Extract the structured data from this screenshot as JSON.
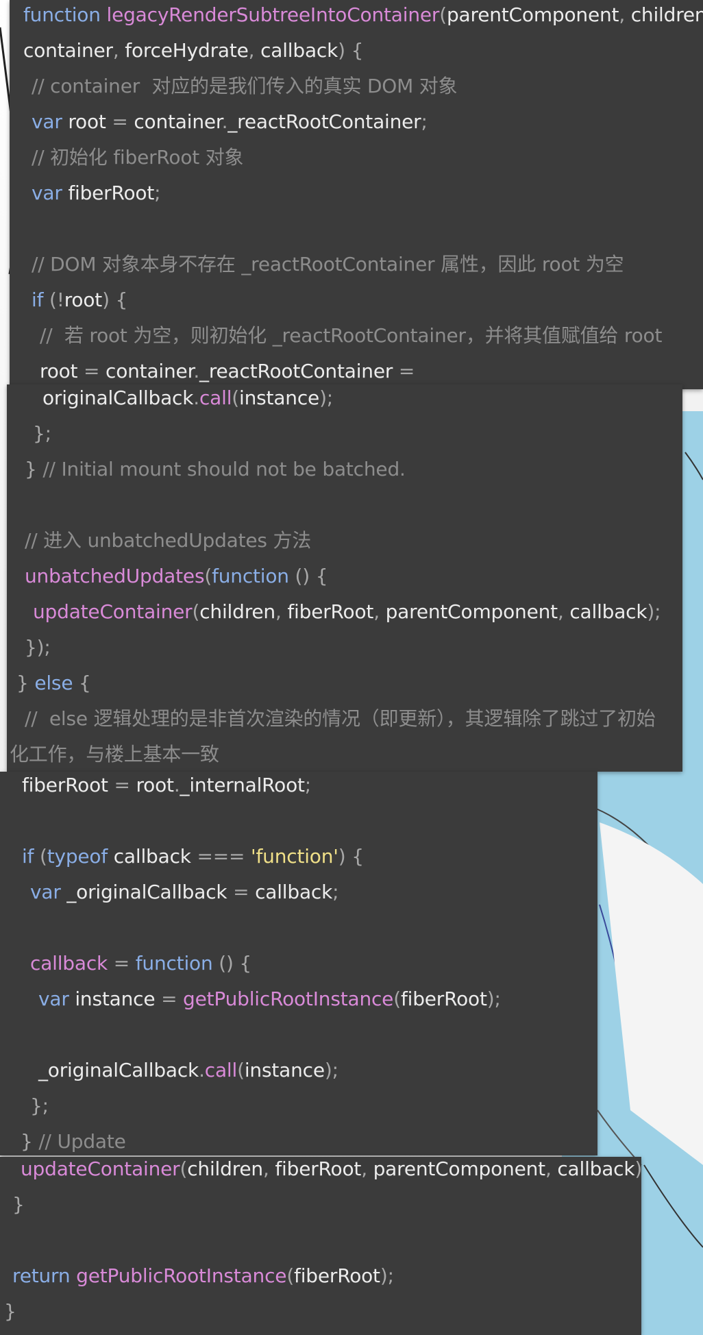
{
  "colors": {
    "panel_bg": "#3b3b3b",
    "keyword": "#8aaee6",
    "function": "#d98ad8",
    "string": "#f0e088",
    "comment": "#8d8d8d",
    "text": "#ececec"
  },
  "blocks": [
    {
      "lines": [
        [
          [
            "function",
            "kw"
          ],
          [
            " ",
            "tx"
          ],
          [
            "legacyRenderSubtreeIntoContainer",
            "fn"
          ],
          [
            "(",
            "pn"
          ],
          [
            "parentComponent",
            "tx"
          ],
          [
            ", ",
            "pn"
          ],
          [
            "children",
            "tx"
          ],
          [
            ",",
            "pn"
          ]
        ],
        [
          [
            "container",
            "tx"
          ],
          [
            ", ",
            "pn"
          ],
          [
            "forceHydrate",
            "tx"
          ],
          [
            ", ",
            "pn"
          ],
          [
            "callback",
            "tx"
          ],
          [
            ") {",
            "pn"
          ]
        ],
        [
          [
            "// container  对应的是我们传入的真实 DOM 对象",
            "cm"
          ]
        ],
        [
          [
            "var",
            "kw"
          ],
          [
            " root ",
            "tx"
          ],
          [
            "=",
            "pn"
          ],
          [
            " container",
            "tx"
          ],
          [
            ".",
            "pn"
          ],
          [
            "_reactRootContainer",
            "tx"
          ],
          [
            ";",
            "pn"
          ]
        ],
        [
          [
            "// 初始化 fiberRoot 对象",
            "cm"
          ]
        ],
        [
          [
            "var",
            "kw"
          ],
          [
            " fiberRoot",
            "tx"
          ],
          [
            ";",
            "pn"
          ]
        ],
        [],
        [
          [
            "// DOM 对象本身不存在 _reactRootContainer 属性，因此 root 为空",
            "cm"
          ]
        ],
        [
          [
            "if",
            "kw"
          ],
          [
            " (",
            "pn"
          ],
          [
            "!",
            "pn"
          ],
          [
            "root",
            "tx"
          ],
          [
            ") {",
            "pn"
          ]
        ],
        [
          [
            "//  若 root 为空，则初始化 _reactRootContainer，并将其值赋值给 root",
            "cm"
          ]
        ],
        [
          [
            "root ",
            "tx"
          ],
          [
            "=",
            "pn"
          ],
          [
            " container",
            "tx"
          ],
          [
            ".",
            "pn"
          ],
          [
            "_reactRootContainer ",
            "tx"
          ],
          [
            "=",
            "pn"
          ]
        ]
      ]
    },
    {
      "lines": [
        [
          [
            "originalCallback",
            "tx"
          ],
          [
            ".",
            "pn"
          ],
          [
            "call",
            "fn"
          ],
          [
            "(",
            "pn"
          ],
          [
            "instance",
            "tx"
          ],
          [
            ");",
            "pn"
          ]
        ],
        [
          [
            "};",
            "pn"
          ]
        ],
        [
          [
            "} ",
            "pn"
          ],
          [
            "// Initial mount should not be batched.",
            "cm"
          ]
        ],
        [],
        [
          [
            "// 进入 unbatchedUpdates 方法",
            "cm"
          ]
        ],
        [
          [
            "unbatchedUpdates",
            "fn"
          ],
          [
            "(",
            "pn"
          ],
          [
            "function",
            "kw"
          ],
          [
            " () {",
            "pn"
          ]
        ],
        [
          [
            "updateContainer",
            "fn"
          ],
          [
            "(",
            "pn"
          ],
          [
            "children",
            "tx"
          ],
          [
            ", ",
            "pn"
          ],
          [
            "fiberRoot",
            "tx"
          ],
          [
            ", ",
            "pn"
          ],
          [
            "parentComponent",
            "tx"
          ],
          [
            ", ",
            "pn"
          ],
          [
            "callback",
            "tx"
          ],
          [
            ");",
            "pn"
          ]
        ],
        [
          [
            "});",
            "pn"
          ]
        ],
        [
          [
            "} ",
            "pn"
          ],
          [
            "else",
            "kw"
          ],
          [
            " {",
            "pn"
          ]
        ],
        [
          [
            "//  else 逻辑处理的是非首次渲染的情况（即更新），其逻辑除了跳过了初始",
            "cm"
          ]
        ],
        [
          [
            "化工作，与楼上基本一致",
            "cm"
          ]
        ]
      ]
    },
    {
      "lines": [
        [
          [
            "fiberRoot ",
            "tx"
          ],
          [
            "=",
            "pn"
          ],
          [
            " root",
            "tx"
          ],
          [
            ".",
            "pn"
          ],
          [
            "_internalRoot",
            "tx"
          ],
          [
            ";",
            "pn"
          ]
        ],
        [],
        [
          [
            "if",
            "kw"
          ],
          [
            " (",
            "pn"
          ],
          [
            "typeof",
            "kw"
          ],
          [
            " callback ",
            "tx"
          ],
          [
            "===",
            "pn"
          ],
          [
            " ",
            "tx"
          ],
          [
            "'function'",
            "str"
          ],
          [
            ") {",
            "pn"
          ]
        ],
        [
          [
            "var",
            "kw"
          ],
          [
            " _originalCallback ",
            "tx"
          ],
          [
            "=",
            "pn"
          ],
          [
            " callback",
            "tx"
          ],
          [
            ";",
            "pn"
          ]
        ],
        [],
        [
          [
            "callback",
            "fn"
          ],
          [
            " = ",
            "pn"
          ],
          [
            "function",
            "kw"
          ],
          [
            " () {",
            "pn"
          ]
        ],
        [
          [
            "var",
            "kw"
          ],
          [
            " instance ",
            "tx"
          ],
          [
            "=",
            "pn"
          ],
          [
            " ",
            "tx"
          ],
          [
            "getPublicRootInstance",
            "fn"
          ],
          [
            "(",
            "pn"
          ],
          [
            "fiberRoot",
            "tx"
          ],
          [
            ");",
            "pn"
          ]
        ],
        [],
        [
          [
            "_originalCallback",
            "tx"
          ],
          [
            ".",
            "pn"
          ],
          [
            "call",
            "fn"
          ],
          [
            "(",
            "pn"
          ],
          [
            "instance",
            "tx"
          ],
          [
            ");",
            "pn"
          ]
        ],
        [
          [
            "};",
            "pn"
          ]
        ],
        [
          [
            "} ",
            "pn"
          ],
          [
            "// Update",
            "cm"
          ]
        ]
      ]
    },
    {
      "lines": [
        [
          [
            "updateContainer",
            "fn"
          ],
          [
            "(",
            "pn"
          ],
          [
            "children",
            "tx"
          ],
          [
            ", ",
            "pn"
          ],
          [
            "fiberRoot",
            "tx"
          ],
          [
            ", ",
            "pn"
          ],
          [
            "parentComponent",
            "tx"
          ],
          [
            ", ",
            "pn"
          ],
          [
            "callback",
            "tx"
          ],
          [
            ");",
            "pn"
          ]
        ],
        [
          [
            "}",
            "pn"
          ]
        ],
        [],
        [
          [
            "return",
            "kw"
          ],
          [
            " ",
            "tx"
          ],
          [
            "getPublicRootInstance",
            "fn"
          ],
          [
            "(",
            "pn"
          ],
          [
            "fiberRoot",
            "tx"
          ],
          [
            ");",
            "pn"
          ]
        ],
        [
          [
            "}",
            "pn"
          ]
        ]
      ]
    }
  ]
}
